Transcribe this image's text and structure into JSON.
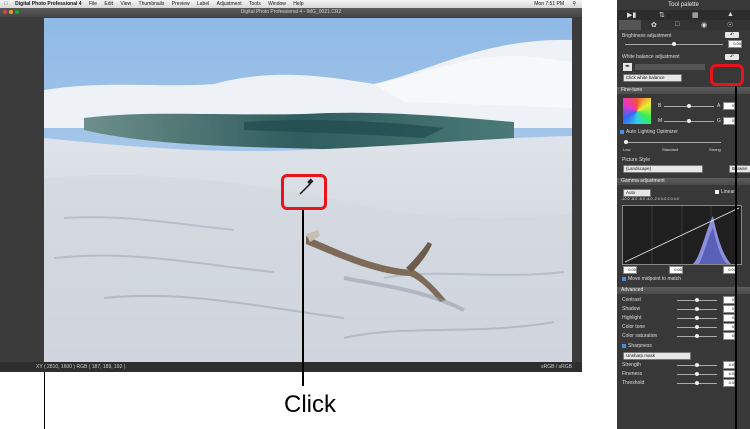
{
  "app": {
    "menu": [
      "Digital Photo Professional 4",
      "File",
      "Edit",
      "View",
      "Thumbnails",
      "Preview",
      "Label",
      "Adjustment",
      "Tools",
      "Window",
      "Help"
    ],
    "clock": "Mon 7:51 PM",
    "window_title": "Digital Photo Professional 4 - IMG_0021.CR2",
    "status_left": "XY ( 2810, 1600 ) RGB ( 187, 189, 192 )",
    "status_right": "sRGB / sRGB"
  },
  "annotation": {
    "click_label": "Click"
  },
  "palette": {
    "title": "Tool palette",
    "brightness": {
      "label": "Brightness adjustment",
      "value": "0.00"
    },
    "white_balance": {
      "label": "White balance adjustment",
      "select": "Click white balance"
    },
    "fine_tune": {
      "label": "Fine-tune",
      "b_label": "B",
      "m_label": "M",
      "a_label": "A",
      "g_label": "G",
      "b_value": "0",
      "m_value": "0"
    },
    "alo": {
      "label": "Auto Lighting Optimizer",
      "low": "Low",
      "standard": "Standard",
      "strong": "Strong"
    },
    "picture_style": {
      "label": "Picture Style",
      "value": "(Landscape)",
      "browse": "Browse"
    },
    "gamma": {
      "label": "Gamma adjustment",
      "auto": "Auto",
      "linear": "Linear",
      "scale": "-10.0 -8.0 -6.0 -4.0 -2.0 0.0 2.0 4.0",
      "v1": "0.00",
      "v2": "0.00",
      "v3": "0.00",
      "move_midpoint": "Move midpoint to match"
    },
    "advanced": {
      "label": "Advanced",
      "rows": [
        {
          "label": "Contrast",
          "value": "0"
        },
        {
          "label": "Shadow",
          "value": "0"
        },
        {
          "label": "Highlight",
          "value": "0"
        },
        {
          "label": "Color tone",
          "value": "0"
        },
        {
          "label": "Color saturation",
          "value": "0"
        }
      ],
      "sharpness_label": "Sharpness",
      "sharpness_mode": "Unsharp mask",
      "sharp_rows": [
        {
          "label": "Strength",
          "value": "4.0"
        },
        {
          "label": "Fineness",
          "value": "4.0"
        },
        {
          "label": "Threshold",
          "value": "4.0"
        }
      ]
    }
  },
  "colors": {
    "callout": "#e8141b",
    "photo_sky": "#9fc3ea",
    "photo_sand": "#e4e8ef",
    "lagoon": "#3f6d6d"
  }
}
